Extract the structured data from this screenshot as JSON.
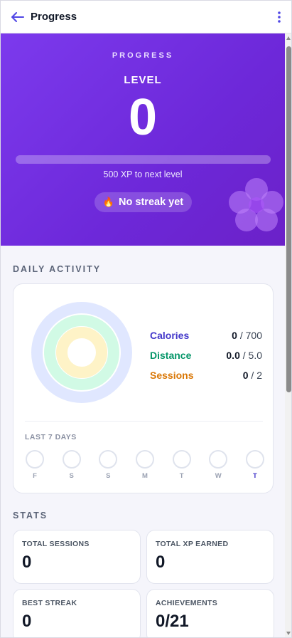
{
  "header": {
    "title": "Progress",
    "back_icon": "arrow-left-icon",
    "more_icon": "more-vertical-icon",
    "accent": "#4f46e5"
  },
  "hero": {
    "kicker": "PROGRESS",
    "level_label": "LEVEL",
    "level_value": "0",
    "xp_progress_fraction": 0,
    "xp_caption": "500 XP to next level",
    "streak_icon": "fire-icon",
    "streak_emoji": "🔥",
    "streak_text": "No streak yet",
    "decoration_icon": "flower-icon",
    "gradient_start": "#7c3aed",
    "gradient_end": "#6b21c8"
  },
  "daily_activity": {
    "heading": "DAILY ACTIVITY",
    "metrics": [
      {
        "name": "Calories",
        "current": "0",
        "goal": "700",
        "separator": " / ",
        "color": "#4338ca",
        "progress": 0
      },
      {
        "name": "Distance",
        "current": "0.0",
        "goal": "5.0",
        "separator": " / ",
        "color": "#059669",
        "progress": 0
      },
      {
        "name": "Sessions",
        "current": "0",
        "goal": "2",
        "separator": " / ",
        "color": "#d97706",
        "progress": 0
      }
    ],
    "last_days_label": "LAST 7 DAYS",
    "days": [
      {
        "letter": "F",
        "active": false,
        "today": false
      },
      {
        "letter": "S",
        "active": false,
        "today": false
      },
      {
        "letter": "S",
        "active": false,
        "today": false
      },
      {
        "letter": "M",
        "active": false,
        "today": false
      },
      {
        "letter": "T",
        "active": false,
        "today": false
      },
      {
        "letter": "W",
        "active": false,
        "today": false
      },
      {
        "letter": "T",
        "active": false,
        "today": true
      }
    ]
  },
  "stats": {
    "heading": "STATS",
    "cards": [
      {
        "label": "TOTAL SESSIONS",
        "value": "0"
      },
      {
        "label": "TOTAL XP EARNED",
        "value": "0"
      },
      {
        "label": "BEST STREAK",
        "value": "0"
      },
      {
        "label": "ACHIEVEMENTS",
        "value": "0/21"
      }
    ]
  }
}
